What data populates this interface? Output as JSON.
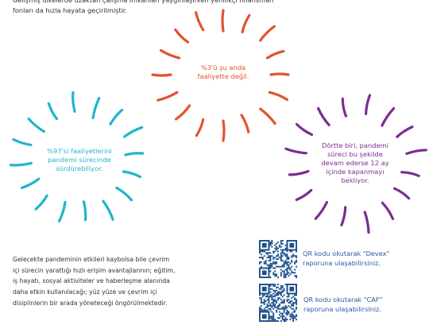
{
  "intro": {
    "text": "Gelişmiş ülkelerde uzaktan çalışma imkânları yaygınlaşırken yenilikçi finansman\nfonları da hızla hayata geçirilmiştir."
  },
  "bursts": [
    {
      "id": "burst-red",
      "color": "#e2532f",
      "text": "%3'ü şu anda\nfaaliyette değil."
    },
    {
      "id": "burst-teal",
      "color": "#20b5cc",
      "text": "%97'si faaliyetlerini\npandemi sürecinde\nsürdürebiliyor."
    },
    {
      "id": "burst-purple",
      "color": "#7b2d90",
      "text": "Dörtte biri, pandemi\nsüreci bu şekilde\ndevam ederse 12 ay\niçinde kapanmayı\nbekliyor."
    }
  ],
  "bottom": {
    "text": "Gelecekte pandeminin etkileri kaybolsa bile çevrim\niçi sürecin yarattığı hızlı erişim avantajlarının; eğitim,\niş hayatı, sosyal aktiviteler ve haberleşme alanında\ndaha etkin kullanılacağı; yüz yüze ve çevrim içi\ndisiplinlerin bir arada yöneteceği öngörülmektedir."
  },
  "qr_codes": [
    {
      "label": "QR kodu okutarak \"Devex\"\nraporuna ulaşabilirsiniz."
    },
    {
      "label": "QR kodu okutarak \"CAF\"\nraporuna ulaşabilirsiniz."
    }
  ],
  "colors": {
    "red": "#e2532f",
    "teal": "#20b5cc",
    "purple": "#7b2d90",
    "link_blue": "#2b5aa8",
    "body_text": "#333333",
    "qr_color": "#1a4f8a"
  }
}
